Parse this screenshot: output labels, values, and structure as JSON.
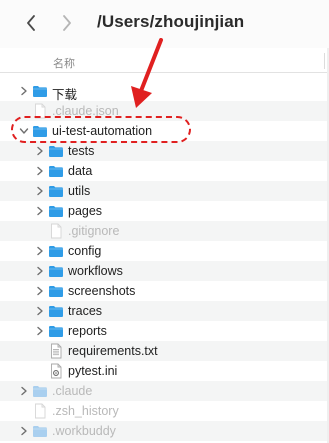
{
  "toolbar": {
    "path_title": "/Users/zhoujinjian"
  },
  "column_header": {
    "name_label": "名称"
  },
  "files": [
    {
      "label": "下载",
      "kind": "folder",
      "expanded": false,
      "depth": 0,
      "hidden": false
    },
    {
      "label": ".claude.json",
      "kind": "file",
      "expanded": false,
      "depth": 0,
      "hidden": true
    },
    {
      "label": "ui-test-automation",
      "kind": "folder",
      "expanded": true,
      "depth": 0,
      "hidden": false
    },
    {
      "label": "tests",
      "kind": "folder",
      "expanded": false,
      "depth": 1,
      "hidden": false
    },
    {
      "label": "data",
      "kind": "folder",
      "expanded": false,
      "depth": 1,
      "hidden": false
    },
    {
      "label": "utils",
      "kind": "folder",
      "expanded": false,
      "depth": 1,
      "hidden": false
    },
    {
      "label": "pages",
      "kind": "folder",
      "expanded": false,
      "depth": 1,
      "hidden": false
    },
    {
      "label": ".gitignore",
      "kind": "file",
      "expanded": false,
      "depth": 1,
      "hidden": true
    },
    {
      "label": "config",
      "kind": "folder",
      "expanded": false,
      "depth": 1,
      "hidden": false
    },
    {
      "label": "workflows",
      "kind": "folder",
      "expanded": false,
      "depth": 1,
      "hidden": false
    },
    {
      "label": "screenshots",
      "kind": "folder",
      "expanded": false,
      "depth": 1,
      "hidden": false
    },
    {
      "label": "traces",
      "kind": "folder",
      "expanded": false,
      "depth": 1,
      "hidden": false
    },
    {
      "label": "reports",
      "kind": "folder",
      "expanded": false,
      "depth": 1,
      "hidden": false
    },
    {
      "label": "requirements.txt",
      "kind": "text-file",
      "expanded": false,
      "depth": 1,
      "hidden": false
    },
    {
      "label": "pytest.ini",
      "kind": "config-file",
      "expanded": false,
      "depth": 1,
      "hidden": false
    },
    {
      "label": ".claude",
      "kind": "folder",
      "expanded": false,
      "depth": 0,
      "hidden": true
    },
    {
      "label": ".zsh_history",
      "kind": "file",
      "expanded": false,
      "depth": 0,
      "hidden": true
    },
    {
      "label": ".workbuddy",
      "kind": "folder",
      "expanded": false,
      "depth": 0,
      "hidden": true
    }
  ],
  "colors": {
    "folder": "#2f9ce6",
    "folder_dim": "#a9cfee",
    "annotation_red": "#e02020",
    "disclosure": "#6f6f6f"
  },
  "icons": {
    "back": "chevron-left-icon",
    "forward": "chevron-right-icon",
    "folder": "folder-icon",
    "file": "document-icon",
    "gear_file": "gear-document-icon"
  }
}
